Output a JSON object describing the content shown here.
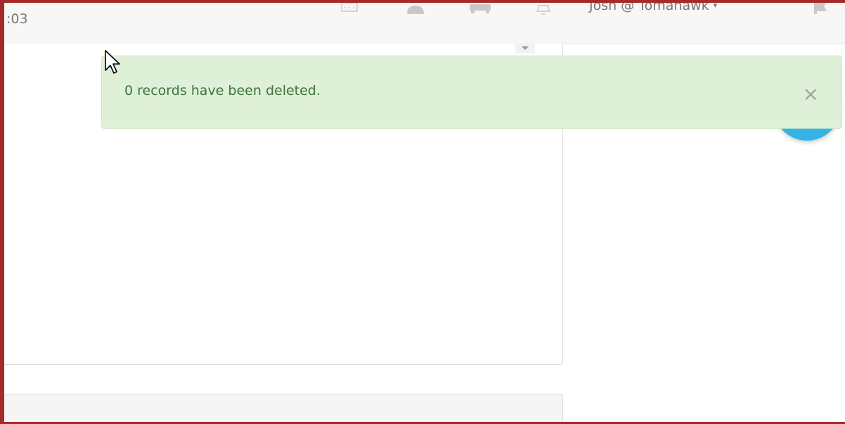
{
  "topbar": {
    "time_fragment": ":03",
    "icons": [
      "calendar-icon",
      "user-icon",
      "car-icon",
      "bell-icon",
      "flag-icon"
    ],
    "user_menu_label": "Josh @ Tomahawk",
    "user_menu_caret": "▾"
  },
  "alert": {
    "message": "0 records have been deleted.",
    "close_label": "×"
  },
  "colors": {
    "alert_background": "#dff0d8",
    "alert_text": "#3c763d",
    "frame_border": "#a52a2a",
    "fab": "#36b3e6"
  }
}
